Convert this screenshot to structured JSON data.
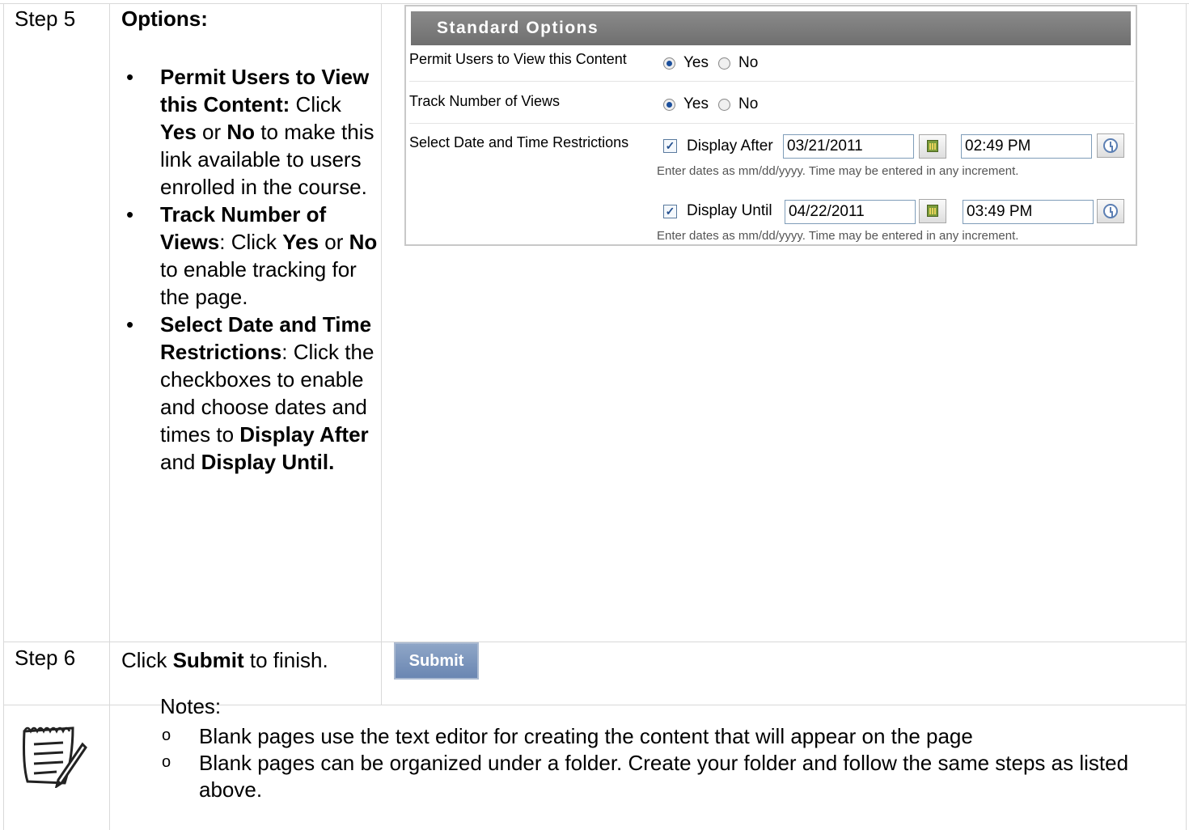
{
  "step5": {
    "label": "Step 5",
    "heading": "Options:",
    "bullets": [
      {
        "parts": [
          {
            "t": "Permit Users to View this Content:",
            "b": true
          },
          {
            "t": " Click ",
            "b": false
          },
          {
            "t": "Yes",
            "b": true
          },
          {
            "t": " or ",
            "b": false
          },
          {
            "t": "No",
            "b": true
          },
          {
            "t": " to make this link available to users enrolled in the course.",
            "b": false
          }
        ]
      },
      {
        "parts": [
          {
            "t": "Track Number of Views",
            "b": true
          },
          {
            "t": ": Click ",
            "b": false
          },
          {
            "t": "Yes",
            "b": true
          },
          {
            "t": " or ",
            "b": false
          },
          {
            "t": "No",
            "b": true
          },
          {
            "t": " to enable tracking for the page.",
            "b": false
          }
        ]
      },
      {
        "parts": [
          {
            "t": "Select Date and Time Restrictions",
            "b": true
          },
          {
            "t": ": Click the checkboxes to enable and choose dates and times to ",
            "b": false
          },
          {
            "t": "Display After",
            "b": true
          },
          {
            "t": " and ",
            "b": false
          },
          {
            "t": "Display Until.",
            "b": true
          }
        ]
      }
    ]
  },
  "panel": {
    "title": "Standard Options",
    "permit_label": "Permit Users to View this Content",
    "track_label": "Track Number of Views",
    "restrict_label": "Select Date and Time Restrictions",
    "yes": "Yes",
    "no": "No",
    "display_after_label": "Display After",
    "display_after_date": "03/21/2011",
    "display_after_time": "02:49 PM",
    "display_until_label": "Display Until",
    "display_until_date": "04/22/2011",
    "display_until_time": "03:49 PM",
    "hint": "Enter dates as mm/dd/yyyy. Time may be entered in any increment."
  },
  "step6": {
    "label": "Step 6",
    "parts": [
      {
        "t": "Click ",
        "b": false
      },
      {
        "t": "Submit",
        "b": true
      },
      {
        "t": " to finish.",
        "b": false
      }
    ],
    "button": "Submit"
  },
  "notes": {
    "title": "Notes:",
    "items": [
      "Blank pages use the text editor for creating the content that will appear on the page",
      "Blank pages can be organized under a folder. Create your folder and follow the same steps as listed above."
    ]
  }
}
